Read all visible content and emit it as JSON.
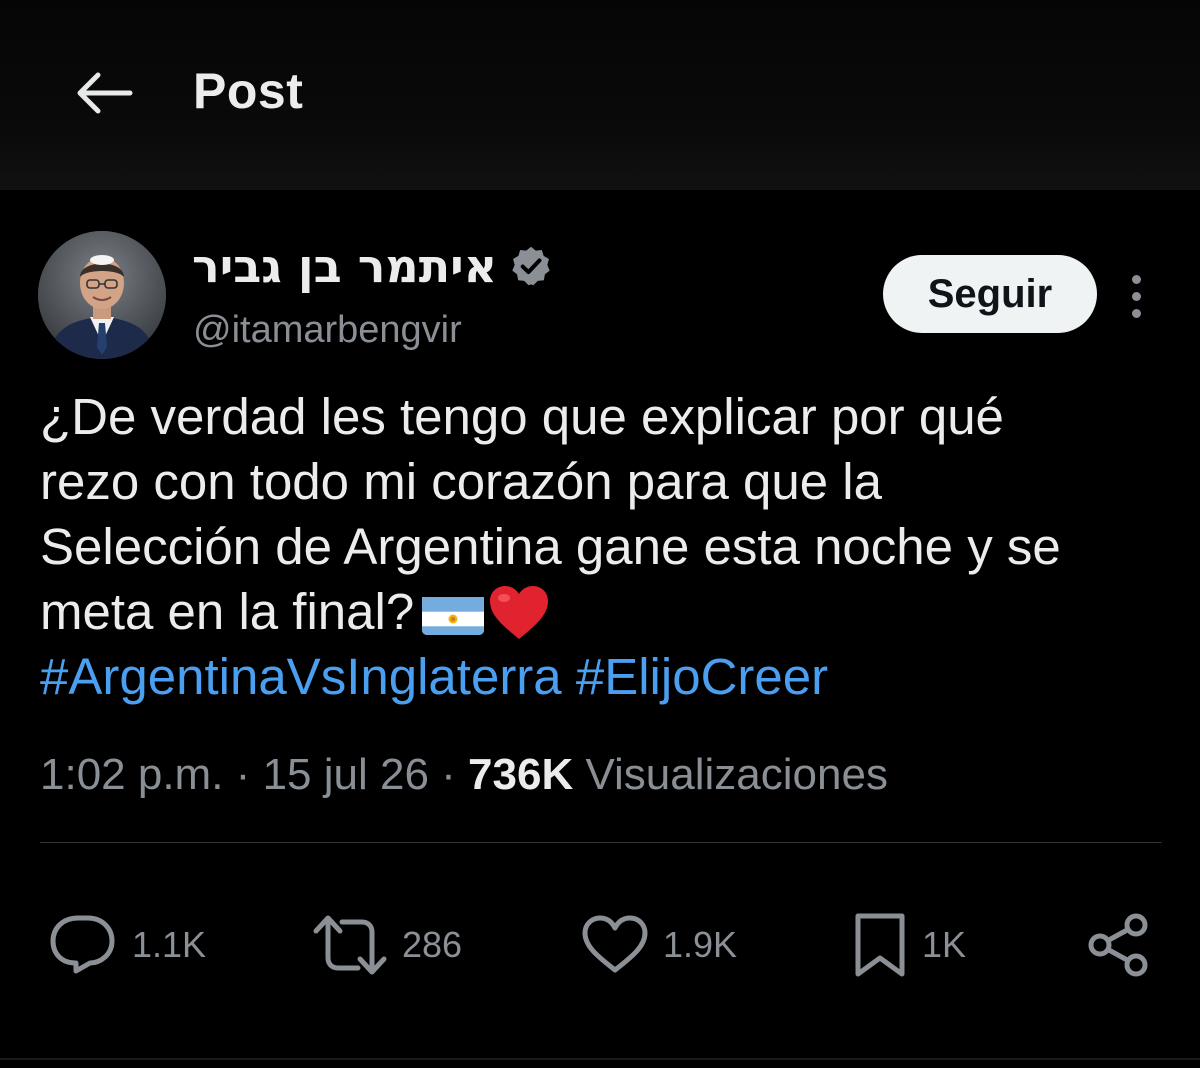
{
  "header": {
    "title": "Post",
    "back_icon": "arrow-left-icon"
  },
  "author": {
    "display_name": "איתמר בן גביר",
    "handle": "@itamarbengvir",
    "verified": true,
    "verified_color": "#8b9096"
  },
  "follow_button": {
    "label": "Seguir"
  },
  "tweet": {
    "lines": [
      "¿De verdad les tengo que explicar por qué",
      "rezo con todo mi corazón para que la",
      "Selección de Argentina gane esta noche y se",
      "meta en la final?"
    ],
    "emojis": [
      "argentina-flag",
      "red-heart"
    ],
    "hashtags": [
      "#ArgentinaVsInglaterra",
      "#ElijoCreer"
    ],
    "hashtag_color": "#4a9ff0"
  },
  "meta": {
    "time": "1:02 p.m.",
    "separator": "·",
    "date": "15 jul 26",
    "views_count": "736K",
    "views_label": "Visualizaciones"
  },
  "actions": {
    "replies": {
      "icon": "reply-icon",
      "count": "1.1K"
    },
    "reposts": {
      "icon": "repost-icon",
      "count": "286"
    },
    "likes": {
      "icon": "heart-icon",
      "count": "1.9K"
    },
    "bookmarks": {
      "icon": "bookmark-icon",
      "count": "1K"
    },
    "share": {
      "icon": "share-icon"
    }
  }
}
